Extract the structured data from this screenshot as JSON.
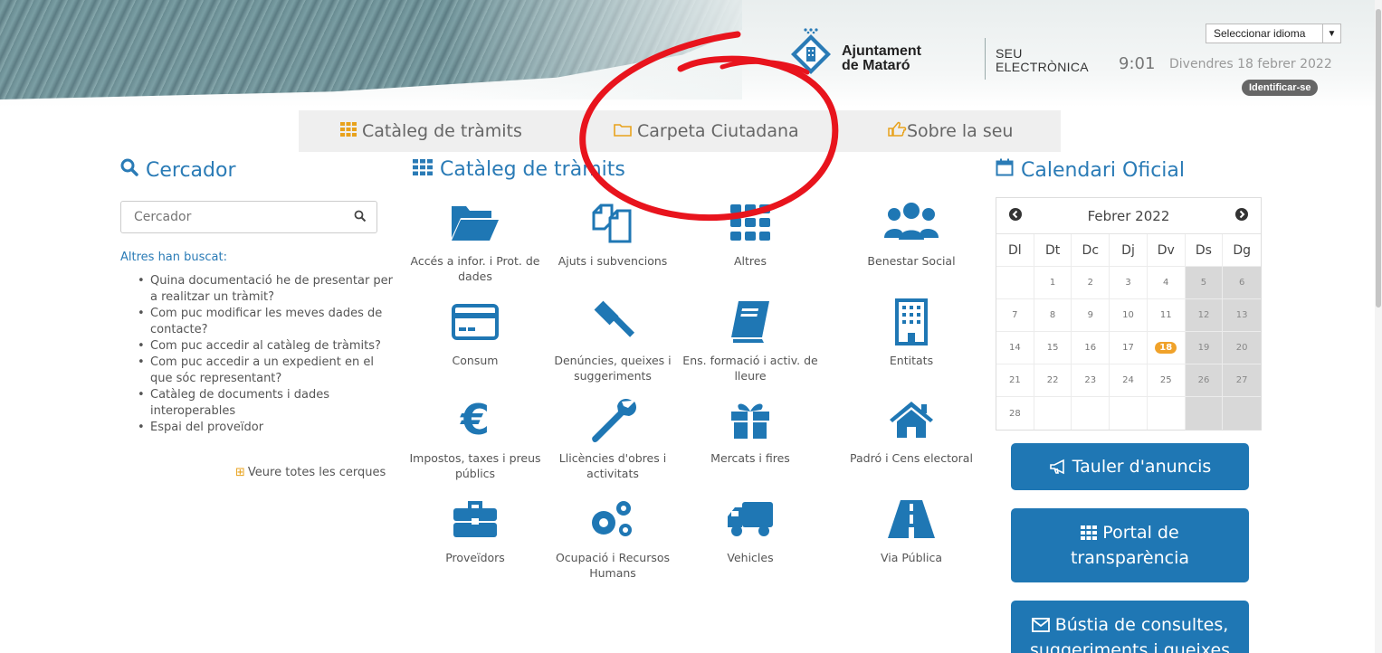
{
  "header": {
    "logo_name": "Ajuntament",
    "logo_name2": "de Mataró",
    "seu_line1": "SEU",
    "seu_line2": "ELECTRÒNICA",
    "time": "9:01",
    "date": "Divendres 18 febrer 2022",
    "language_select": "Seleccionar idioma",
    "login_button": "Identificar-se"
  },
  "topnav": {
    "tabs": [
      {
        "label": "Catàleg de tràmits",
        "icon": "grid-icon"
      },
      {
        "label": "Carpeta Ciutadana",
        "icon": "folder-icon"
      },
      {
        "label": "Sobre la seu",
        "icon": "hand-pointer-icon"
      }
    ]
  },
  "search": {
    "heading": "Cercador",
    "placeholder": "Cercador",
    "others_title": "Altres han buscat:",
    "others": [
      "Quina documentació he de presentar per a realitzar un tràmit?",
      "Com puc modificar les meves dades de contacte?",
      "Com puc accedir al catàleg de tràmits?",
      "Com puc accedir a un expedient en el que sóc representant?",
      "Catàleg de documents i dades interoperables",
      "Espai del proveïdor"
    ],
    "see_all": "Veure totes les cerques"
  },
  "catalog": {
    "heading": "Catàleg de tràmits",
    "items": [
      {
        "label": "Accés a infor. i Prot. de dades",
        "icon": "folder-open-icon"
      },
      {
        "label": "Ajuts i subvencions",
        "icon": "copy-icon"
      },
      {
        "label": "Altres",
        "icon": "grid-icon"
      },
      {
        "label": "Benestar Social",
        "icon": "users-icon"
      },
      {
        "label": "Consum",
        "icon": "credit-card-icon"
      },
      {
        "label": "Denúncies, queixes i suggeriments",
        "icon": "gavel-icon"
      },
      {
        "label": "Ens. formació i activ. de lleure",
        "icon": "book-icon"
      },
      {
        "label": "Entitats",
        "icon": "building-icon"
      },
      {
        "label": "Impostos, taxes i preus públics",
        "icon": "euro-icon"
      },
      {
        "label": "Llicències d'obres i activitats",
        "icon": "wrench-icon"
      },
      {
        "label": "Mercats i fires",
        "icon": "gift-icon"
      },
      {
        "label": "Padró i Cens electoral",
        "icon": "home-icon"
      },
      {
        "label": "Proveïdors",
        "icon": "briefcase-icon"
      },
      {
        "label": "Ocupació i Recursos Humans",
        "icon": "cogs-icon"
      },
      {
        "label": "Vehicles",
        "icon": "truck-icon"
      },
      {
        "label": "Via Pública",
        "icon": "road-icon"
      }
    ]
  },
  "calendar": {
    "heading": "Calendari Oficial",
    "month": "Febrer 2022",
    "prev": "‹",
    "next": "›",
    "weekdays": [
      "Dl",
      "Dt",
      "Dc",
      "Dj",
      "Dv",
      "Ds",
      "Dg"
    ],
    "weeks": [
      [
        "",
        "1",
        "2",
        "3",
        "4",
        "5",
        "6"
      ],
      [
        "7",
        "8",
        "9",
        "10",
        "11",
        "12",
        "13"
      ],
      [
        "14",
        "15",
        "16",
        "17",
        "18",
        "19",
        "20"
      ],
      [
        "21",
        "22",
        "23",
        "24",
        "25",
        "26",
        "27"
      ],
      [
        "28",
        "",
        "",
        "",
        "",
        "",
        ""
      ]
    ],
    "today": "18"
  },
  "buttons": {
    "tauler": "Tauler d'anuncis",
    "portal_line1": "Portal de",
    "portal_line2": "transparència",
    "bustia_line1": "Bústia de consultes,",
    "bustia_line2": "suggeriments i queixes"
  },
  "colors": {
    "accent": "#1f77b4",
    "heading": "#2a7bb6",
    "today": "#f0a22a",
    "annotation": "#e8141d"
  }
}
